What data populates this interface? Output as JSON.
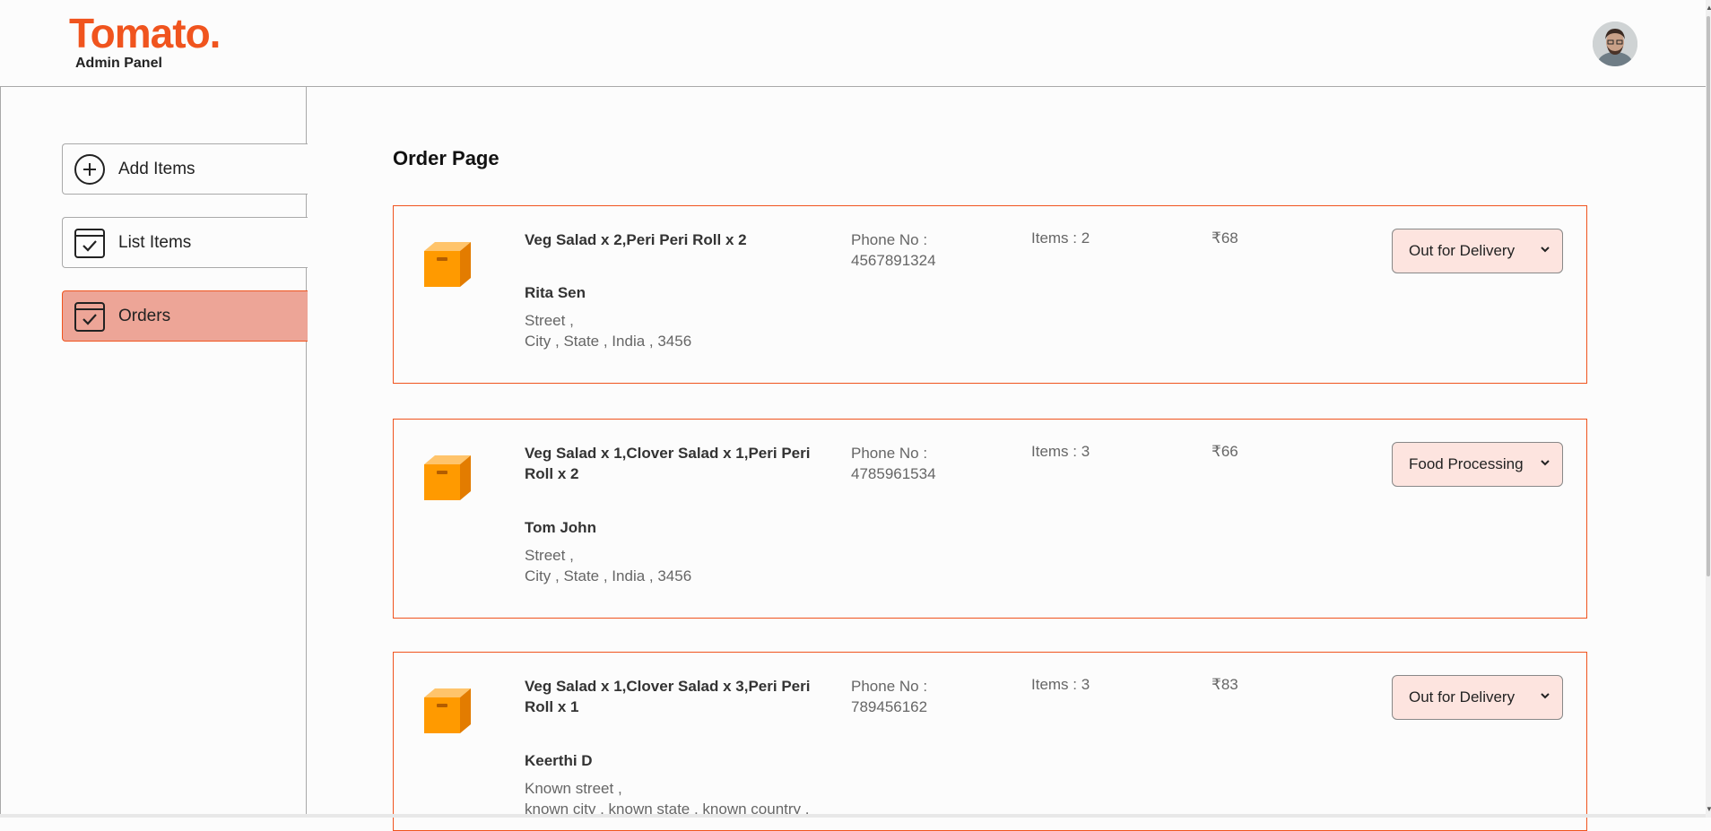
{
  "brand": {
    "name": "Tomato.",
    "subtitle": "Admin Panel"
  },
  "sidebar": {
    "items": [
      {
        "label": "Add Items",
        "icon": "add-circle-icon",
        "active": false
      },
      {
        "label": "List Items",
        "icon": "checklist-icon",
        "active": false
      },
      {
        "label": "Orders",
        "icon": "checklist-icon",
        "active": true
      }
    ]
  },
  "main": {
    "title": "Order Page",
    "orders": [
      {
        "items": "Veg Salad x 2,Peri Peri Roll x 2",
        "customer": "Rita Sen",
        "address_line1": "Street ,",
        "address_line2": "City , State , India , 3456",
        "phone_label": "Phone No :",
        "phone": "4567891324",
        "count": "Items : 2",
        "amount": "₹68",
        "status": "Out for Delivery"
      },
      {
        "items": "Veg Salad x 1,Clover Salad x 1,Peri Peri Roll x 2",
        "customer": "Tom John",
        "address_line1": "Street ,",
        "address_line2": "City , State , India , 3456",
        "phone_label": "Phone No :",
        "phone": "4785961534",
        "count": "Items : 3",
        "amount": "₹66",
        "status": "Food Processing"
      },
      {
        "items": "Veg Salad x 1,Clover Salad x 3,Peri Peri Roll x 1",
        "customer": "Keerthi D",
        "address_line1": "Known street ,",
        "address_line2": "known city , known state , known country ,",
        "phone_label": "Phone No :",
        "phone": "789456162",
        "count": "Items : 3",
        "amount": "₹83",
        "status": "Out for Delivery"
      }
    ]
  },
  "colors": {
    "accent": "#f0541e",
    "active_bg": "#eda597",
    "select_bg": "#fde4df"
  }
}
